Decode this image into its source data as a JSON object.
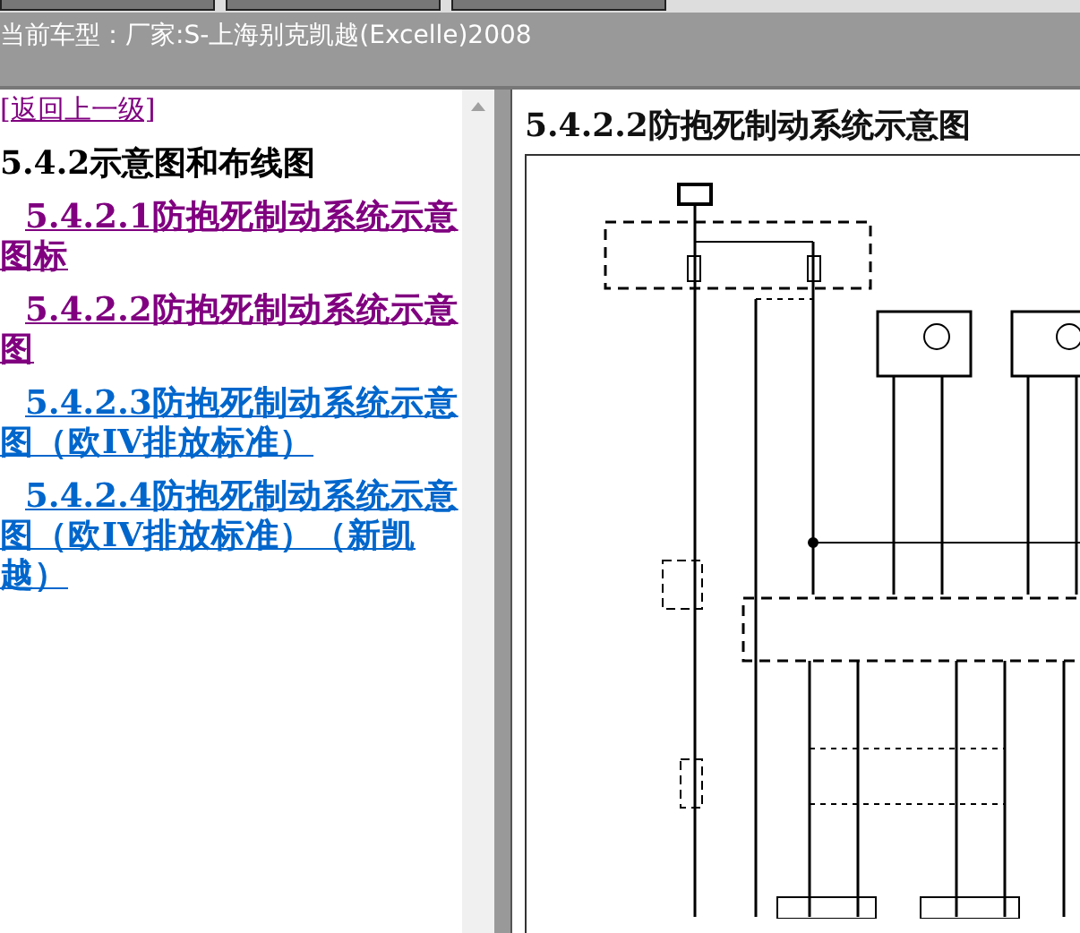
{
  "model_bar": {
    "text": "当前车型：厂家:S-上海别克凯越(Excelle)2008"
  },
  "nav": {
    "back_link": {
      "text": "[返回上一级]",
      "visited": true
    },
    "heading": "5.4.2示意图和布线图",
    "links": [
      {
        "text": "5.4.2.1防抱死制动系统示意图标",
        "visited": true
      },
      {
        "text": "5.4.2.2防抱死制动系统示意图",
        "visited": true
      },
      {
        "text": "5.4.2.3防抱死制动系统示意图（欧IV排放标准）",
        "visited": false
      },
      {
        "text": "5.4.2.4防抱死制动系统示意图（欧IV排放标准）（新凯越）",
        "visited": false
      }
    ]
  },
  "content": {
    "title": "5.4.2.2防抱死制动系统示意图"
  }
}
